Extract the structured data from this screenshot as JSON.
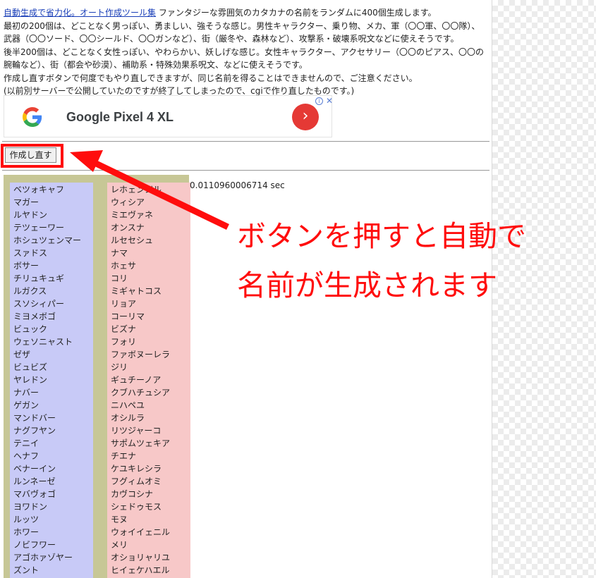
{
  "intro": {
    "link_text": "自動生成で省力化。オート作成ツール集",
    "line1_rest": " ファンタジーな雰囲気のカタカナの名前をランダムに400個生成します。",
    "line2": "最初の200個は、どことなく男っぽい、勇ましい、強そうな感じ。男性キャラクター、乗り物、メカ、軍（〇〇軍、〇〇隊）、",
    "line3": "武器（〇〇ソード、〇〇シールド、〇〇ガンなど）、街（厳冬や、森林など）、攻撃系・破壊系呪文などに使えそうです。",
    "line4": "後半200個は、どことなく女性っぽい、やわらかい、妖しげな感じ。女性キャラクター、アクセサリー（〇〇のピアス、〇〇の",
    "line5": "腕輪など）、街（都会や砂漠）、補助系・特殊効果系呪文、などに使えそうです。",
    "line6": "作成し直すボタンで何度でもやり直しできますが、同じ名前を得ることはできませんので、ご注意ください。",
    "line7": "(以前別サーバーで公開していたのですが終了してしまったので、cgiで作り直したものです。)"
  },
  "ad": {
    "logo_icon": "google-g-icon",
    "text": "Google Pixel 4 XL",
    "go_icon": "chevron-right-icon",
    "info_icon": "info-icon",
    "close_icon": "close-icon"
  },
  "redo_button": {
    "label": "作成し直す"
  },
  "timing_text": "0.0110960006714 sec",
  "male_names": [
    "ベツォキャフ",
    "マガー",
    "ルヤドン",
    "テツェーワー",
    "ホシュツェンマー",
    "スァドス",
    "ボサー",
    "チリュキュギ",
    "ルガクス",
    "スソシィパー",
    "ミヨメボゴ",
    "ビュック",
    "ウェソニャスト",
    "ゼザ",
    "ビュビズ",
    "ヤレドン",
    "ナバー",
    "ゲガン",
    "マンドバー",
    "ナグフヤン",
    "テニイ",
    "ヘナフ",
    "ベナーイン",
    "ルンネーゼ",
    "マバヴォゴ",
    "ヨワドン",
    "ルッツ",
    "ホワー",
    "ノビフワー",
    "アゴホァゾヤー",
    "ズント"
  ],
  "female_names": [
    "レホェンジル",
    "ウィシア",
    "ミエヴァネ",
    "オンスナ",
    "ルセセシュ",
    "ナマ",
    "ホェサ",
    "コリ",
    "ミギャトコス",
    "リョア",
    "コーリマ",
    "ビズナ",
    "フォリ",
    "ファボヌーレラ",
    "ジリ",
    "ギュチーノア",
    "クブハチュシア",
    "ニハペユ",
    "オシルラ",
    "リツジャーコ",
    "サポムツェキア",
    "チエナ",
    "ケユキレシラ",
    "フグィムオミ",
    "カヴコシナ",
    "シェドゥモス",
    "モヌ",
    "ウォイイェニル",
    "メリ",
    "オショリャリユ",
    "ヒイェケハエル"
  ],
  "callout": {
    "line1": "ボタンを押すと自動で",
    "line2": "名前が生成されます"
  },
  "colors": {
    "highlight_red": "#ff0d0d",
    "male_column": "#c8caf7",
    "female_column": "#f7c8c8",
    "table_frame": "#c7c796",
    "link": "#1a3fb8"
  }
}
